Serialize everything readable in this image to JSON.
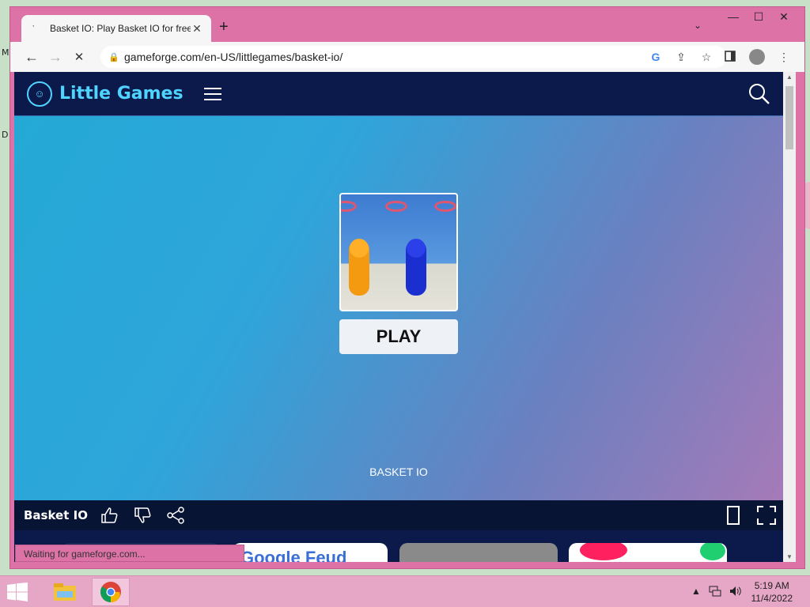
{
  "desktop": {
    "mark1": "M",
    "mark2": "D"
  },
  "browser": {
    "tab_title": "Basket IO: Play Basket IO for free",
    "tab_close": "✕",
    "new_tab": "+",
    "tab_search": "⌄",
    "window_controls": {
      "minimize": "—",
      "maximize": "☐",
      "close": "✕"
    },
    "nav": {
      "back": "←",
      "forward": "→",
      "stop": "✕"
    },
    "url": "gameforge.com/en-US/littlegames/basket-io/",
    "lock": "🔒",
    "omnibox_icons": {
      "google": "G",
      "share": "⇪",
      "bookmark": "☆"
    },
    "menu": "⋮",
    "status": "Waiting for gameforge.com..."
  },
  "site": {
    "logo_text": "Little Games",
    "logo_face": "☺"
  },
  "game": {
    "play_label": "PLAY",
    "name_caption": "BASKET IO",
    "bar_title": "Basket IO"
  },
  "related_cards": [
    {
      "text": "",
      "color": "#1a2a5a"
    },
    {
      "text": "Google Feud",
      "color": "#ffffff"
    },
    {
      "text": "",
      "color": "#8a8a8a"
    },
    {
      "text": "",
      "color": "#ffffff"
    }
  ],
  "taskbar": {
    "time": "5:19 AM",
    "date": "11/4/2022",
    "tray_arrow": "▲"
  },
  "colors": {
    "header_bg": "#0b1a4a",
    "logo_accent": "#4fd3ff",
    "window_frame": "#dd72a7"
  }
}
